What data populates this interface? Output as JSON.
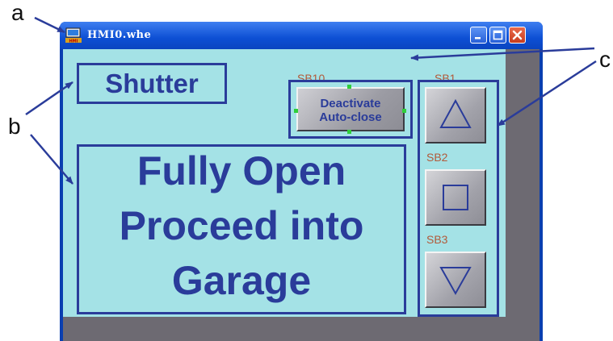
{
  "callouts": {
    "a": "a",
    "b": "b",
    "c": "c"
  },
  "window": {
    "title": "HMI0.whe",
    "controls": [
      "minimize",
      "maximize",
      "close"
    ]
  },
  "screen": {
    "shutter_label": "Shutter",
    "status_lines": [
      "Fully Open",
      "Proceed into",
      "Garage"
    ],
    "deactivate_tag": "SB10",
    "deactivate_button": [
      "Deactivate",
      "Auto-close"
    ],
    "buttons": [
      {
        "tag": "SB1",
        "icon": "triangle-up-icon"
      },
      {
        "tag": "SB2",
        "icon": "square-icon"
      },
      {
        "tag": "SB3",
        "icon": "triangle-down-icon"
      }
    ]
  },
  "colors": {
    "screen_bg": "#a4e2e6",
    "text_blue": "#2a3c9a",
    "tag_color": "#b25a3a",
    "titlebar": "#0d4fd4",
    "client_gray": "#6d6a72"
  }
}
